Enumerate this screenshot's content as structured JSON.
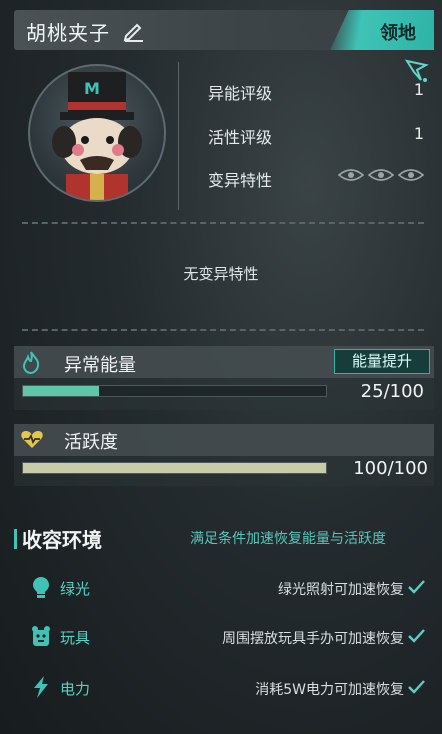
{
  "header": {
    "title": "胡桃夹子",
    "territory_label": "领地"
  },
  "stats": [
    {
      "label": "异能评级",
      "value": "1"
    },
    {
      "label": "活性评级",
      "value": "1"
    },
    {
      "label": "变异特性",
      "value": ""
    }
  ],
  "mutation": {
    "empty_text": "无变异特性"
  },
  "energy": {
    "title": "异常能量",
    "boost_label": "能量提升",
    "value_text": "25/100",
    "current": 25,
    "max": 100,
    "color": "#5fc6a8"
  },
  "activity": {
    "title": "活跃度",
    "value_text": "100/100",
    "current": 100,
    "max": 100,
    "color": "#c9cca8"
  },
  "containment": {
    "title": "收容环境",
    "hint": "满足条件加速恢复能量与活跃度",
    "conditions": [
      {
        "icon": "lightbulb-icon",
        "label": "绿光",
        "desc": "绿光照射可加速恢复"
      },
      {
        "icon": "toy-icon",
        "label": "玩具",
        "desc": "周围摆放玩具手办可加速恢复"
      },
      {
        "icon": "lightning-icon",
        "label": "电力",
        "desc": "消耗5W电力可加速恢复"
      }
    ]
  },
  "colors": {
    "accent": "#3fc3b6",
    "text": "#e8ecef",
    "energy_icon": "#3fc3b6",
    "activity_icon": "#e3c64a"
  }
}
